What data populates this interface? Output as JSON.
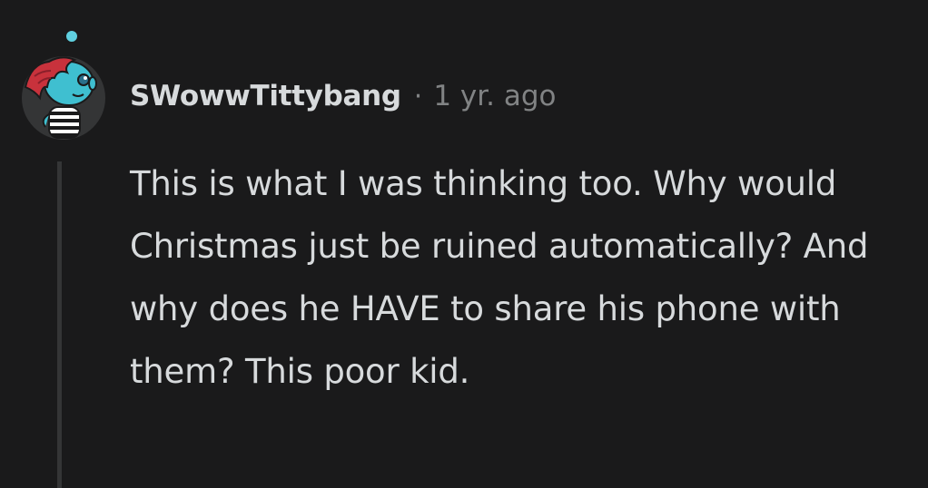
{
  "comment": {
    "author": "SWowwTittybang",
    "separator": "·",
    "timestamp": "1 yr. ago",
    "body": "This is what I was thinking too. Why would Christmas just be ruined automatically? And why does he HAVE to share his phone with them? This poor kid."
  },
  "icons": {
    "avatar": "snoo-avatar-icon"
  },
  "colors": {
    "background": "#1a1a1b",
    "text": "#d7dadc",
    "meta": "#818384",
    "thread_line": "#343536",
    "avatar_hair": "#c8323c",
    "avatar_skin": "#3fbfd0"
  }
}
